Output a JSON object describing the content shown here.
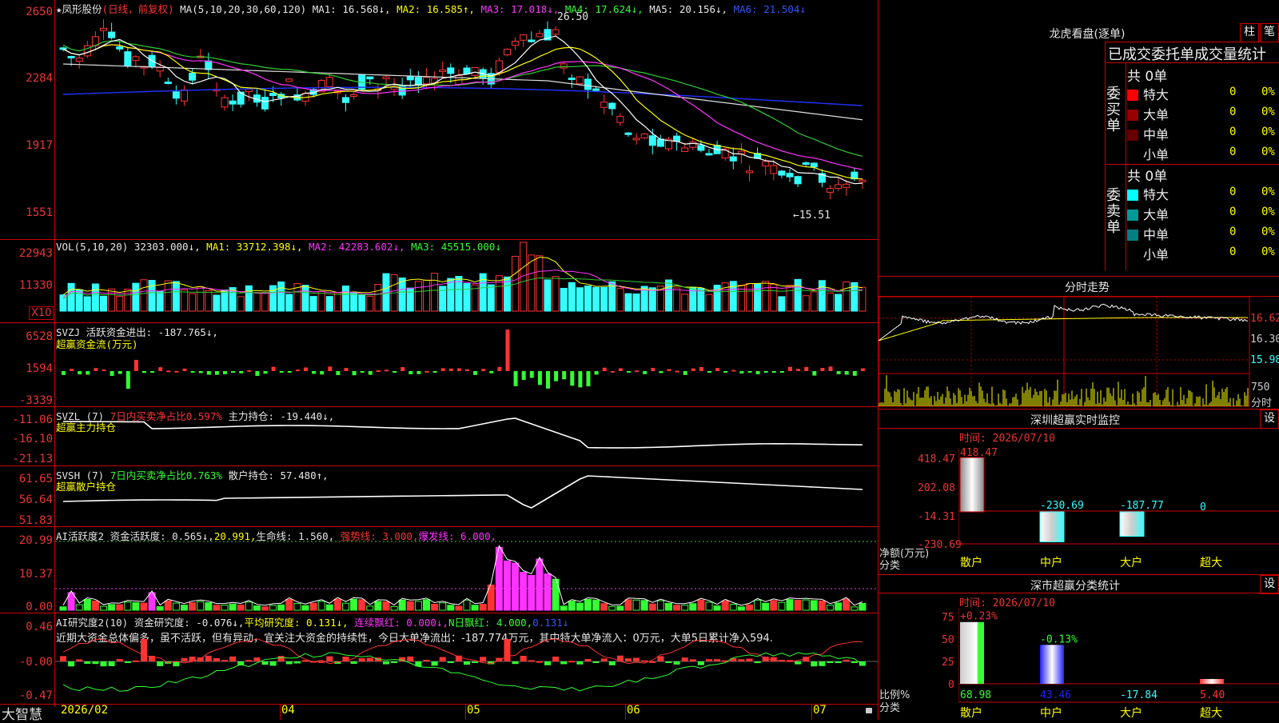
{
  "stock": {
    "star": "★",
    "name": "凤形股份",
    "period": "(日线，前复权)",
    "ma_label": "MA(5,10,20,30,60,120)",
    "ma1": "MA1: 16.568↓,",
    "ma2": "MA2: 16.585↑,",
    "ma3": "MA3: 17.018↓,",
    "ma4": "MA4: 17.624↓,",
    "ma5": "MA5: 20.156↓,",
    "ma6": "MA6: 21.504↓",
    "high_mark": "26.50",
    "low_mark": "←15.51",
    "y_ticks": [
      "2650",
      "2284",
      "1917",
      "1551"
    ]
  },
  "volume": {
    "title": "VOL(5,10,20) ",
    "val": "32303.000↓,",
    "ma1": "MA1: 33712.398↓,",
    "ma2": "MA2: 42283.602↓,",
    "ma3": "MA3: 45515.000↓",
    "y_ticks": [
      "22943",
      "11330"
    ],
    "unit": "X10"
  },
  "svzj": {
    "title": "SVZJ  活跃资金进出: -187.765↓,",
    "subtitle": "超赢资金流(万元)",
    "y_ticks": [
      "6528",
      "1594",
      "-3339"
    ]
  },
  "svzl": {
    "title_a": "SVZL (7) ",
    "title_b": "7日内买卖净占比0.597%",
    "title_c": " 主力持仓: -19.440↓,",
    "subtitle": "超赢主力持仓",
    "y_ticks": [
      "-11.06",
      "-16.10",
      "-21.13"
    ]
  },
  "svsh": {
    "title_a": "SVSH (7) ",
    "title_b": "7日内买卖净占比0.763%",
    "title_c": " 散户持仓: 57.480↑,",
    "subtitle": "超赢散户持仓",
    "y_ticks": [
      "61.65",
      "56.64",
      "51.83"
    ]
  },
  "ai_active": {
    "t1": "AI活跃度2 资金活跃度: 0.565↓,",
    "t2": "20.991,",
    "t3": "生命线: 1.560,",
    "t4": "强势线: 3.000,",
    "t5": "爆发线: 6.000,",
    "y_ticks": [
      "20.99",
      "10.37",
      "0.00"
    ]
  },
  "ai_research": {
    "t1": "AI研究度2(10) 资金研究度: -0.076↓,",
    "t2": "平均研究度: 0.131↓,",
    "t3": "连续飘红: 0.000↓,",
    "t4": "N日飘红: 4.000,",
    "t5": "0.131↓",
    "comment": "近期大资金总体偏多，虽不活跃，但有异动，宜关注大资金的持续性，今日大单净流出：-187.774万元，其中特大单净流入：0万元，大单5日累计净入594.",
    "y_ticks": [
      "0.46",
      "-0.00",
      "-0.47"
    ]
  },
  "xaxis": {
    "brand": "大智慧",
    "labels": [
      "2026/02",
      "04",
      "05",
      "06",
      "07"
    ]
  },
  "dragon": {
    "title": "龙虎看盘(逐单)",
    "btn_bar": "柱",
    "btn_pen": "笔",
    "header": "已成交委托单成交量统计",
    "buy_label": "委买单",
    "sell_label": "委卖单",
    "buy_total": "共 0单",
    "sell_total": "共 0单",
    "buy_rows": [
      {
        "name": "特大",
        "color": "#ff0000",
        "qty": "0",
        "pct": "0%"
      },
      {
        "name": "大单",
        "color": "#990000",
        "qty": "0",
        "pct": "0%"
      },
      {
        "name": "中单",
        "color": "#660000",
        "qty": "0",
        "pct": "0%"
      },
      {
        "name": "小单",
        "color": "#000000",
        "qty": "0",
        "pct": "0%"
      }
    ],
    "sell_rows": [
      {
        "name": "特大",
        "color": "#00ffff",
        "qty": "0",
        "pct": "0%"
      },
      {
        "name": "大单",
        "color": "#009999",
        "qty": "0",
        "pct": "0%"
      },
      {
        "name": "中单",
        "color": "#008080",
        "qty": "0",
        "pct": "0%"
      },
      {
        "name": "小单",
        "color": "#000000",
        "qty": "0",
        "pct": "0%"
      }
    ]
  },
  "intraday": {
    "title": "分时走势",
    "p1": "16.62",
    "p2": "16.30",
    "p3": "15.98",
    "v1": "750",
    "v2": "分时"
  },
  "sz_monitor": {
    "title": "深圳超赢实时监控",
    "btn": "设",
    "time": "时间: 2026/07/10",
    "y_ticks": [
      "418.47",
      "202.08",
      "-14.31",
      "-230.69"
    ],
    "bars": [
      {
        "label": "散户",
        "value": 418.47,
        "text": "418.47"
      },
      {
        "label": "中户",
        "value": -230.69,
        "text": "-230.69"
      },
      {
        "label": "大户",
        "value": -187.77,
        "text": "-187.77"
      },
      {
        "label": "超大",
        "value": 0,
        "text": "0"
      }
    ],
    "ylabel": "净额(万元)",
    "xlabel": "分类"
  },
  "sz_stats": {
    "title": "深市超赢分类统计",
    "btn": "设",
    "time": "时间: 2026/07/10",
    "y_ticks": [
      "75",
      "50",
      "25",
      "0"
    ],
    "bars": [
      {
        "label": "散户",
        "pct": "+0.23%",
        "value": 68.98,
        "text": "68.98"
      },
      {
        "label": "中户",
        "pct": "-0.13%",
        "value": 43.46,
        "text": "43.46"
      },
      {
        "label": "大户",
        "pct": "",
        "value": -17.84,
        "text": "-17.84"
      },
      {
        "label": "超大",
        "pct": "",
        "value": 5.4,
        "text": "5.40"
      }
    ],
    "ylabel": "比例%",
    "xlabel": "分类"
  }
}
